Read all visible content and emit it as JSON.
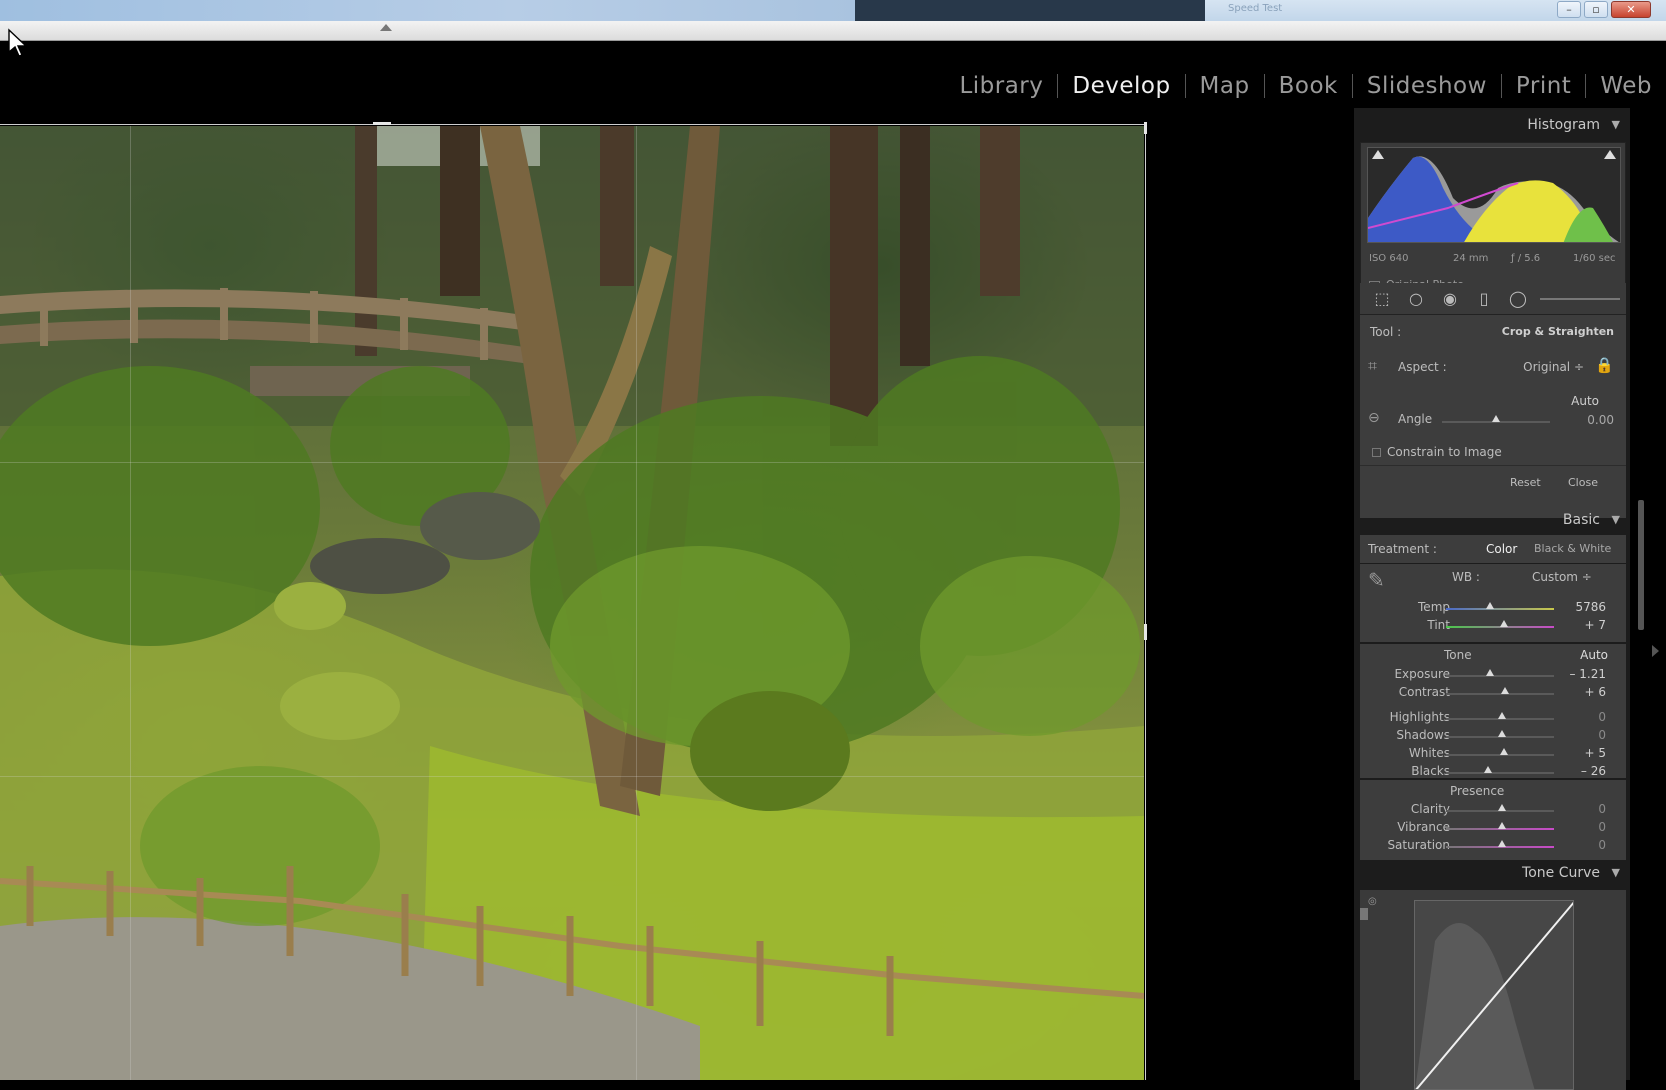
{
  "window": {
    "title": "Speed Test",
    "controls": {
      "minimize": "–",
      "maximize": "▫",
      "close": "✕"
    }
  },
  "modules": {
    "items": [
      {
        "label": "Library",
        "active": false
      },
      {
        "label": "Develop",
        "active": true
      },
      {
        "label": "Map",
        "active": false
      },
      {
        "label": "Book",
        "active": false
      },
      {
        "label": "Slideshow",
        "active": false
      },
      {
        "label": "Print",
        "active": false
      },
      {
        "label": "Web",
        "active": false
      }
    ]
  },
  "histogram": {
    "header": "Histogram",
    "iso": "ISO 640",
    "focal": "24 mm",
    "aperture": "ƒ / 5.6",
    "shutter": "1/60 sec",
    "original_photo": "Original Photo"
  },
  "crop": {
    "tool_label": "Tool :",
    "tool_value": "Crop & Straighten",
    "aspect_label": "Aspect :",
    "aspect_value": "Original ÷",
    "auto": "Auto",
    "angle_label": "Angle",
    "angle_value": "0.00",
    "constrain_label": "Constrain to Image",
    "reset": "Reset",
    "close": "Close"
  },
  "basic": {
    "header": "Basic",
    "treatment_label": "Treatment :",
    "treatment_color": "Color",
    "treatment_bw": "Black & White",
    "wb_label": "WB :",
    "wb_value": "Custom ÷",
    "temp_label": "Temp",
    "temp_value": "5786",
    "tint_label": "Tint",
    "tint_value": "+ 7",
    "tone_label": "Tone",
    "tone_auto": "Auto",
    "exposure_label": "Exposure",
    "exposure_value": "– 1.21",
    "contrast_label": "Contrast",
    "contrast_value": "+ 6",
    "highlights_label": "Highlights",
    "highlights_value": "0",
    "shadows_label": "Shadows",
    "shadows_value": "0",
    "whites_label": "Whites",
    "whites_value": "+ 5",
    "blacks_label": "Blacks",
    "blacks_value": "– 26",
    "presence_label": "Presence",
    "clarity_label": "Clarity",
    "clarity_value": "0",
    "vibrance_label": "Vibrance",
    "vibrance_value": "0",
    "saturation_label": "Saturation",
    "saturation_value": "0"
  },
  "tone_curve": {
    "header": "Tone Curve"
  },
  "colors": {
    "accent": "#f0f0f0",
    "panel": "#3d3d3d",
    "background": "#000000"
  }
}
